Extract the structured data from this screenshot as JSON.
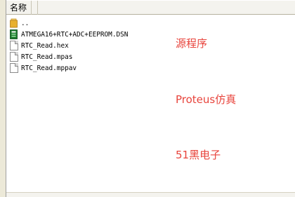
{
  "header": {
    "name_column_label": "名称"
  },
  "files": [
    {
      "name": "..",
      "icon": "folder-up-icon"
    },
    {
      "name": "ATMEGA16+RTC+ADC+EEPROM.DSN",
      "icon": "proteus-dsn-icon"
    },
    {
      "name": "RTC_Read.hex",
      "icon": "file-icon"
    },
    {
      "name": "RTC_Read.mpas",
      "icon": "file-icon"
    },
    {
      "name": "RTC_Read.mppav",
      "icon": "file-icon"
    }
  ],
  "annotations": {
    "source_label": "源程序",
    "proteus_label": "Proteus仿真",
    "brand_label": "51黑电子"
  },
  "colors": {
    "annotation": "#e8443c",
    "folder": "#e8b030",
    "dsn_icon": "#1b7a2c"
  }
}
